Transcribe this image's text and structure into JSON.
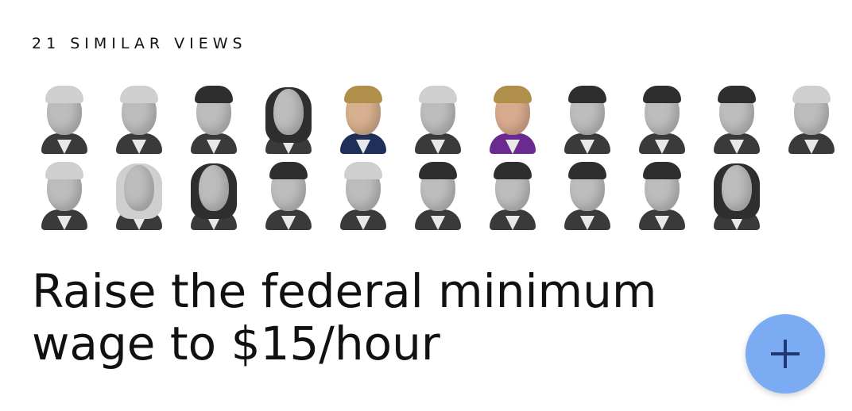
{
  "similar_views": {
    "label": "21 SIMILAR VIEWS",
    "rows": [
      [
        {
          "name": "face-1",
          "style": "light-hair"
        },
        {
          "name": "face-2",
          "style": "light-hair"
        },
        {
          "name": "face-3",
          "style": ""
        },
        {
          "name": "face-4",
          "style": "long-hair"
        },
        {
          "name": "face-5",
          "style": "color color-blue color-hair-blonde"
        },
        {
          "name": "face-6",
          "style": "light-hair"
        },
        {
          "name": "face-7",
          "style": "color color-hair-blonde"
        },
        {
          "name": "face-8",
          "style": ""
        },
        {
          "name": "face-9",
          "style": ""
        },
        {
          "name": "face-10",
          "style": ""
        },
        {
          "name": "face-11",
          "style": "light-hair"
        }
      ],
      [
        {
          "name": "face-12",
          "style": "light-hair"
        },
        {
          "name": "face-13",
          "style": "long-hair light-hair"
        },
        {
          "name": "face-14",
          "style": "long-hair"
        },
        {
          "name": "face-15",
          "style": ""
        },
        {
          "name": "face-16",
          "style": "light-hair"
        },
        {
          "name": "face-17",
          "style": ""
        },
        {
          "name": "face-18",
          "style": ""
        },
        {
          "name": "face-19",
          "style": ""
        },
        {
          "name": "face-20",
          "style": ""
        },
        {
          "name": "face-21",
          "style": "long-hair"
        }
      ]
    ]
  },
  "position": {
    "title": "Raise the federal minimum wage to $15/hour"
  },
  "add_button": {
    "icon": "plus-icon",
    "color": "#7aabf3",
    "icon_color": "#1f3a73"
  }
}
